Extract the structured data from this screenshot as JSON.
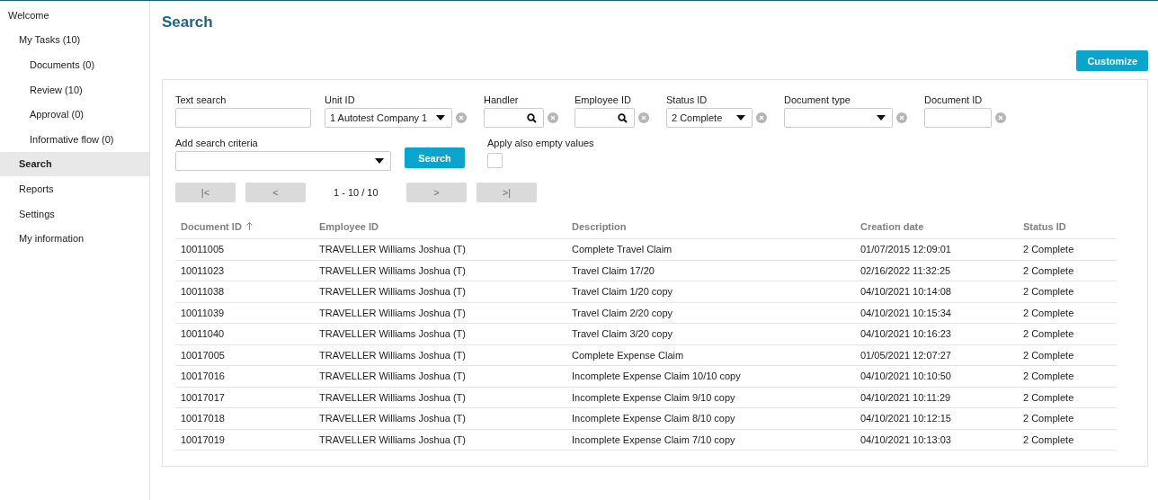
{
  "sidebar": {
    "items": [
      {
        "label": "Welcome",
        "selected": false,
        "children": [
          {
            "label": "My Tasks (10)",
            "selected": false,
            "children": [
              {
                "label": "Documents (0)",
                "selected": false
              },
              {
                "label": "Review (10)",
                "selected": false
              },
              {
                "label": "Approval (0)",
                "selected": false
              },
              {
                "label": "Informative flow (0)",
                "selected": false
              }
            ]
          },
          {
            "label": "Search",
            "selected": true
          },
          {
            "label": "Reports",
            "selected": false
          },
          {
            "label": "Settings",
            "selected": false
          },
          {
            "label": "My information",
            "selected": false
          }
        ]
      }
    ]
  },
  "page_title": "Search",
  "customize_button": "Customize",
  "filters": [
    {
      "kind": "text",
      "label": "Text search",
      "clearable": false
    },
    {
      "kind": "select",
      "label": "Unit ID",
      "value": "1 Autotest Company 1",
      "clearable": true
    },
    {
      "kind": "lookup",
      "label": "Handler",
      "clearable": true
    },
    {
      "kind": "lookup",
      "label": "Employee ID",
      "clearable": true
    },
    {
      "kind": "select",
      "label": "Status ID",
      "value": "2 Complete",
      "clearable": true
    },
    {
      "kind": "select",
      "label": "Document type",
      "clearable": true
    },
    {
      "kind": "text",
      "label": "Document ID",
      "clearable": true
    }
  ],
  "add_criteria": {
    "label": "Add search criteria"
  },
  "search_button": "Search",
  "apply_empty": {
    "label": "Apply also empty values",
    "checked": false
  },
  "pager": {
    "first": {
      "label": "|<",
      "disabled": true
    },
    "prev": {
      "label": "<",
      "disabled": true
    },
    "range": "1 - 10 / 10",
    "next": {
      "label": ">",
      "disabled": true
    },
    "last": {
      "label": ">|",
      "disabled": true
    }
  },
  "table": {
    "columns": [
      {
        "label": "Document ID",
        "sorted": true
      },
      {
        "label": "Employee ID",
        "sorted": false
      },
      {
        "label": "Description",
        "sorted": false
      },
      {
        "label": "Creation date",
        "sorted": false
      },
      {
        "label": "Status ID",
        "sorted": false
      }
    ],
    "rows": [
      [
        "10011005",
        "TRAVELLER Williams Joshua (T)",
        "Complete Travel Claim",
        "01/07/2015 12:09:01",
        "2 Complete"
      ],
      [
        "10011023",
        "TRAVELLER Williams Joshua (T)",
        "Travel Claim 17/20",
        "02/16/2022 11:32:25",
        "2 Complete"
      ],
      [
        "10011038",
        "TRAVELLER Williams Joshua (T)",
        "Travel Claim 1/20 copy",
        "04/10/2021 10:14:08",
        "2 Complete"
      ],
      [
        "10011039",
        "TRAVELLER Williams Joshua (T)",
        "Travel Claim 2/20 copy",
        "04/10/2021 10:15:34",
        "2 Complete"
      ],
      [
        "10011040",
        "TRAVELLER Williams Joshua (T)",
        "Travel Claim 3/20 copy",
        "04/10/2021 10:16:23",
        "2 Complete"
      ],
      [
        "10017005",
        "TRAVELLER Williams Joshua (T)",
        "Complete Expense Claim",
        "01/05/2021 12:07:27",
        "2 Complete"
      ],
      [
        "10017016",
        "TRAVELLER Williams Joshua (T)",
        "Incomplete Expense Claim 10/10 copy",
        "04/10/2021 10:10:50",
        "2 Complete"
      ],
      [
        "10017017",
        "TRAVELLER Williams Joshua (T)",
        "Incomplete Expense Claim 9/10 copy",
        "04/10/2021 10:11:29",
        "2 Complete"
      ],
      [
        "10017018",
        "TRAVELLER Williams Joshua (T)",
        "Incomplete Expense Claim 8/10 copy",
        "04/10/2021 10:12:15",
        "2 Complete"
      ],
      [
        "10017019",
        "TRAVELLER Williams Joshua (T)",
        "Incomplete Expense Claim 7/10 copy",
        "04/10/2021 10:13:03",
        "2 Complete"
      ]
    ]
  }
}
